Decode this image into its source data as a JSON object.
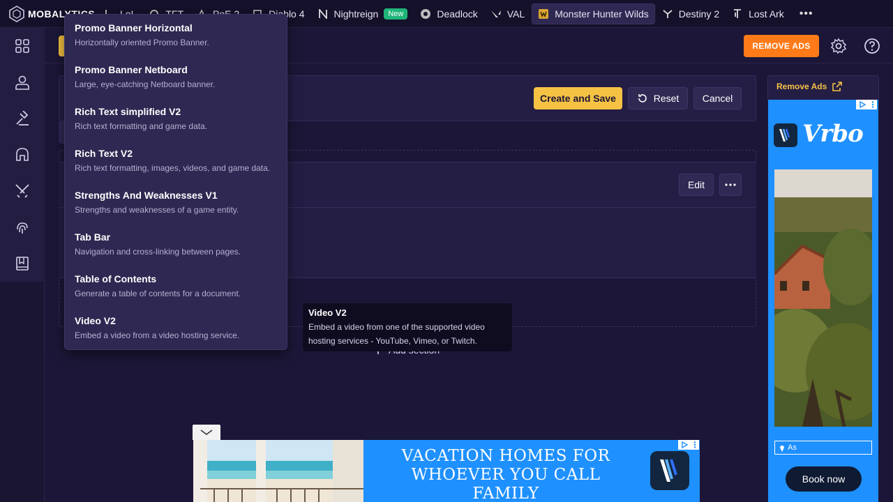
{
  "brand": {
    "name": "MOBALYTICS"
  },
  "nav": {
    "items": [
      {
        "label": "LoL",
        "icon": "lol-icon"
      },
      {
        "label": "TFT",
        "icon": "tft-icon"
      },
      {
        "label": "PoE 2",
        "icon": "poe2-icon"
      },
      {
        "label": "Diablo 4",
        "icon": "diablo-icon"
      },
      {
        "label": "Nightreign",
        "icon": "nightreign-icon",
        "badge": "New"
      },
      {
        "label": "Deadlock",
        "icon": "deadlock-icon"
      },
      {
        "label": "VAL",
        "icon": "valorant-icon"
      },
      {
        "label": "Monster Hunter Wilds",
        "icon": "monster-hunter-icon",
        "active": true
      },
      {
        "label": "Destiny 2",
        "icon": "destiny-icon"
      },
      {
        "label": "Lost Ark",
        "icon": "lost-ark-icon"
      }
    ],
    "more": "•••"
  },
  "header": {
    "remove_ads": "REMOVE ADS"
  },
  "editor": {
    "create_save": "Create and Save",
    "reset": "Reset",
    "cancel": "Cancel",
    "edit": "Edit",
    "add_section": "Add section"
  },
  "dropdown": {
    "items": [
      {
        "title": "Promo Banner Horizontal",
        "desc": "Horizontally oriented Promo Banner."
      },
      {
        "title": "Promo Banner Netboard",
        "desc": "Large, eye-catching Netboard banner."
      },
      {
        "title": "Rich Text simplified V2",
        "desc": "Rich text formatting and game data."
      },
      {
        "title": "Rich Text V2",
        "desc": "Rich text formatting, images, videos, and game data."
      },
      {
        "title": "Strengths And Weaknesses V1",
        "desc": "Strengths and weaknesses of a game entity."
      },
      {
        "title": "Tab Bar",
        "desc": "Navigation and cross-linking between pages."
      },
      {
        "title": "Table of Contents",
        "desc": "Generate a table of contents for a document."
      },
      {
        "title": "Video V2",
        "desc": "Embed a video from a video hosting service."
      }
    ]
  },
  "tooltip": {
    "title": "Video V2",
    "line1": "Embed a video from one of the supported video",
    "line2": "hosting services - YouTube, Vimeo, or Twitch."
  },
  "sidebar_ad": {
    "remove_ads": "Remove Ads",
    "logo_text": "Vrbo",
    "input_placeholder": "As",
    "book_now": "Book now"
  },
  "banner_ad": {
    "line1": "VACATION HOMES FOR",
    "line2": "WHOEVER YOU CALL",
    "line3": "FAMILY"
  },
  "colors": {
    "accent_yellow": "#f6c244",
    "accent_orange": "#ff7a18",
    "new_badge": "#1fb579",
    "ad_blue": "#1e90ff"
  }
}
